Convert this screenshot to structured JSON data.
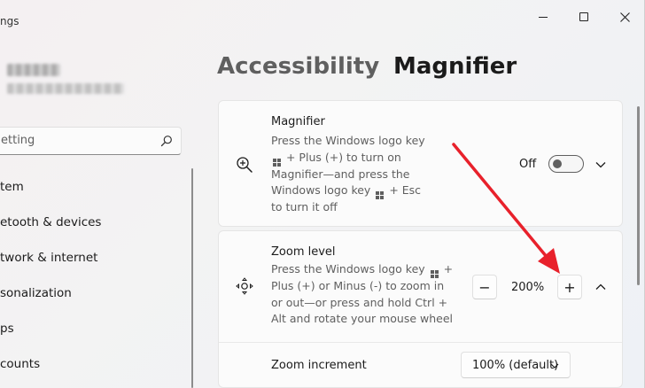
{
  "window": {
    "title_fragment": "ngs",
    "controls": {
      "minimize": "minimize-icon",
      "maximize": "maximize-icon",
      "close": "close-icon"
    }
  },
  "sidebar": {
    "search_value": "etting",
    "items": [
      {
        "label": "tem"
      },
      {
        "label": "etooth & devices"
      },
      {
        "label": "twork & internet"
      },
      {
        "label": "sonalization"
      },
      {
        "label": "ps"
      },
      {
        "label": "counts"
      }
    ]
  },
  "header": {
    "parent": "Accessibility",
    "separator": "›",
    "current": "Magnifier"
  },
  "magnifier_card": {
    "title": "Magnifier",
    "desc_lines": [
      "Press the Windows logo key",
      "+ Plus (+) to turn on",
      "Magnifier—and press the",
      "Windows logo key",
      "+ Esc",
      "to turn it off"
    ],
    "toggle_label": "Off",
    "toggle_on": false,
    "icon": "zoom-in-icon"
  },
  "zoom_card": {
    "title": "Zoom level",
    "desc_lines": [
      "Press the Windows logo key",
      "+",
      "Plus (+) or Minus (-) to zoom in",
      "or out—or press and hold Ctrl +",
      "Alt and rotate your mouse wheel"
    ],
    "value": "200%",
    "minus": "−",
    "plus": "+",
    "icon": "move-icon",
    "increment_label": "Zoom increment",
    "increment_value": "100% (default)"
  },
  "colors": {
    "annotation_arrow": "#e8212b",
    "accent_text": "#1b1b1b",
    "secondary_text": "#5f5f5f"
  }
}
